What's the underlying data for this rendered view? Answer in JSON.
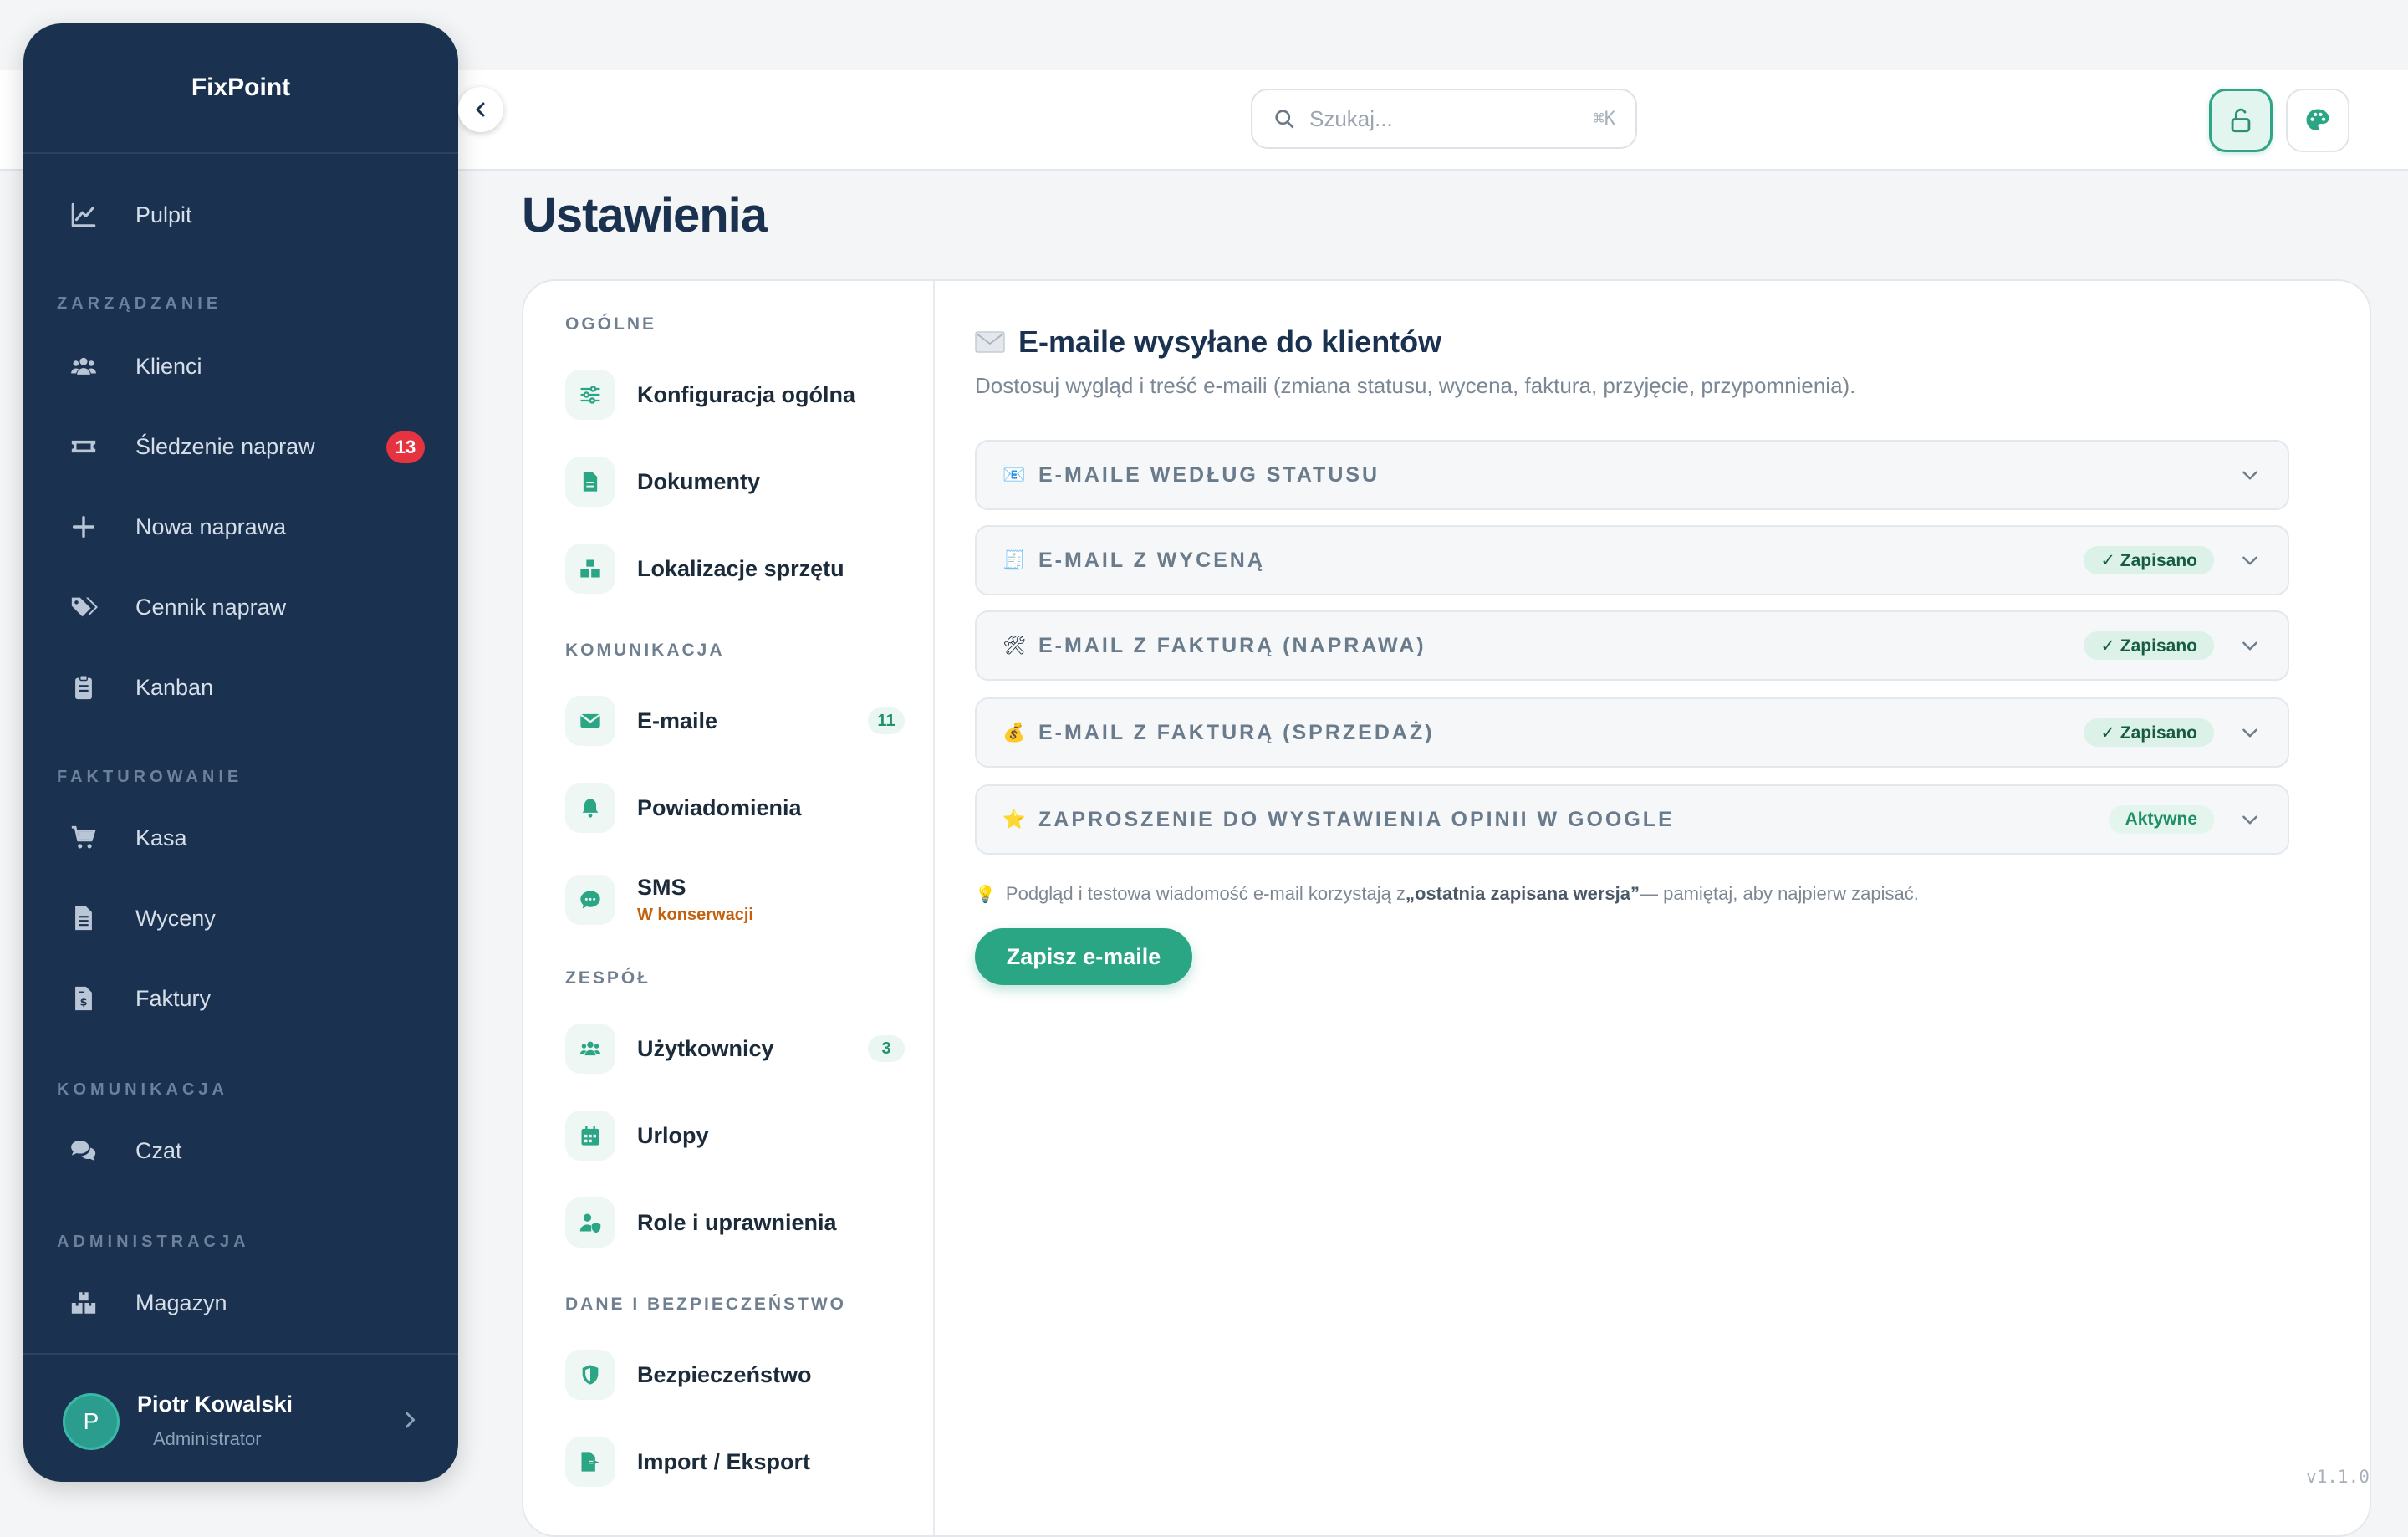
{
  "app": {
    "brand": "FixPoint",
    "version": "v1.1.0"
  },
  "topbar": {
    "search_placeholder": "Szukaj...",
    "search_shortcut": "⌘K"
  },
  "sidebar": {
    "items": [
      {
        "label": "Pulpit",
        "icon": "chart-line-icon"
      },
      {
        "label": "Klienci",
        "icon": "users-icon"
      },
      {
        "label": "Śledzenie napraw",
        "icon": "ticket-icon",
        "badge": "13"
      },
      {
        "label": "Nowa naprawa",
        "icon": "plus-icon"
      },
      {
        "label": "Cennik napraw",
        "icon": "tags-icon"
      },
      {
        "label": "Kanban",
        "icon": "clipboard-icon"
      },
      {
        "label": "Kasa",
        "icon": "cart-icon"
      },
      {
        "label": "Wyceny",
        "icon": "file-lines-icon"
      },
      {
        "label": "Faktury",
        "icon": "invoice-icon"
      },
      {
        "label": "Czat",
        "icon": "comments-icon"
      },
      {
        "label": "Magazyn",
        "icon": "boxes-icon"
      }
    ],
    "sections": {
      "management": "ZARZĄDZANIE",
      "billing": "FAKTUROWANIE",
      "communication": "KOMUNIKACJA",
      "administration": "ADMINISTRACJA"
    },
    "user": {
      "initial": "P",
      "name": "Piotr Kowalski",
      "role": "Administrator"
    }
  },
  "page": {
    "title": "Ustawienia"
  },
  "settings_nav": {
    "sections": {
      "general": "OGÓLNE",
      "communication": "KOMUNIKACJA",
      "team": "ZESPÓŁ",
      "data_security": "DANE I BEZPIECZEŃSTWO"
    },
    "items": {
      "general_config": "Konfiguracja ogólna",
      "documents": "Dokumenty",
      "locations": "Lokalizacje sprzętu",
      "emails": "E-maile",
      "emails_count": "11",
      "notifications": "Powiadomienia",
      "sms": "SMS",
      "sms_status": "W konserwacji",
      "users": "Użytkownicy",
      "users_count": "3",
      "leaves": "Urlopy",
      "roles": "Role i uprawnienia",
      "security": "Bezpieczeństwo",
      "import_export": "Import / Eksport"
    }
  },
  "emails_panel": {
    "title": "E-maile wysyłane do klientów",
    "description": "Dostosuj wygląd i treść e-maili (zmiana statusu, wycena, faktura, przyjęcie, przypomnienia).",
    "accordions": [
      {
        "emoji": "📧",
        "title": "E-MAILE WEDŁUG STATUSU",
        "badge": ""
      },
      {
        "emoji": "🧾",
        "title": "E-MAIL Z WYCENĄ",
        "badge": "✓ Zapisano"
      },
      {
        "emoji": "🛠",
        "title": "E-MAIL Z FAKTURĄ (NAPRAWA)",
        "badge": "✓ Zapisano"
      },
      {
        "emoji": "💰",
        "title": "E-MAIL Z FAKTURĄ (SPRZEDAŻ)",
        "badge": "✓ Zapisano"
      },
      {
        "emoji": "⭐",
        "title": "ZAPROSZENIE DO WYSTAWIENIA OPINII W GOOGLE",
        "badge": "Aktywne"
      }
    ],
    "note_prefix": "Podgląd i testowa wiadomość e-mail korzystają z ",
    "note_bold": "„ostatnia zapisana wersja”",
    "note_suffix": " — pamiętaj, aby najpierw zapisać.",
    "save_label": "Zapisz e-maile"
  },
  "colors": {
    "sidebar_bg": "#1b3150",
    "accent": "#2ba685",
    "badge_red": "#e5343f",
    "maintenance_orange": "#c2620f"
  }
}
